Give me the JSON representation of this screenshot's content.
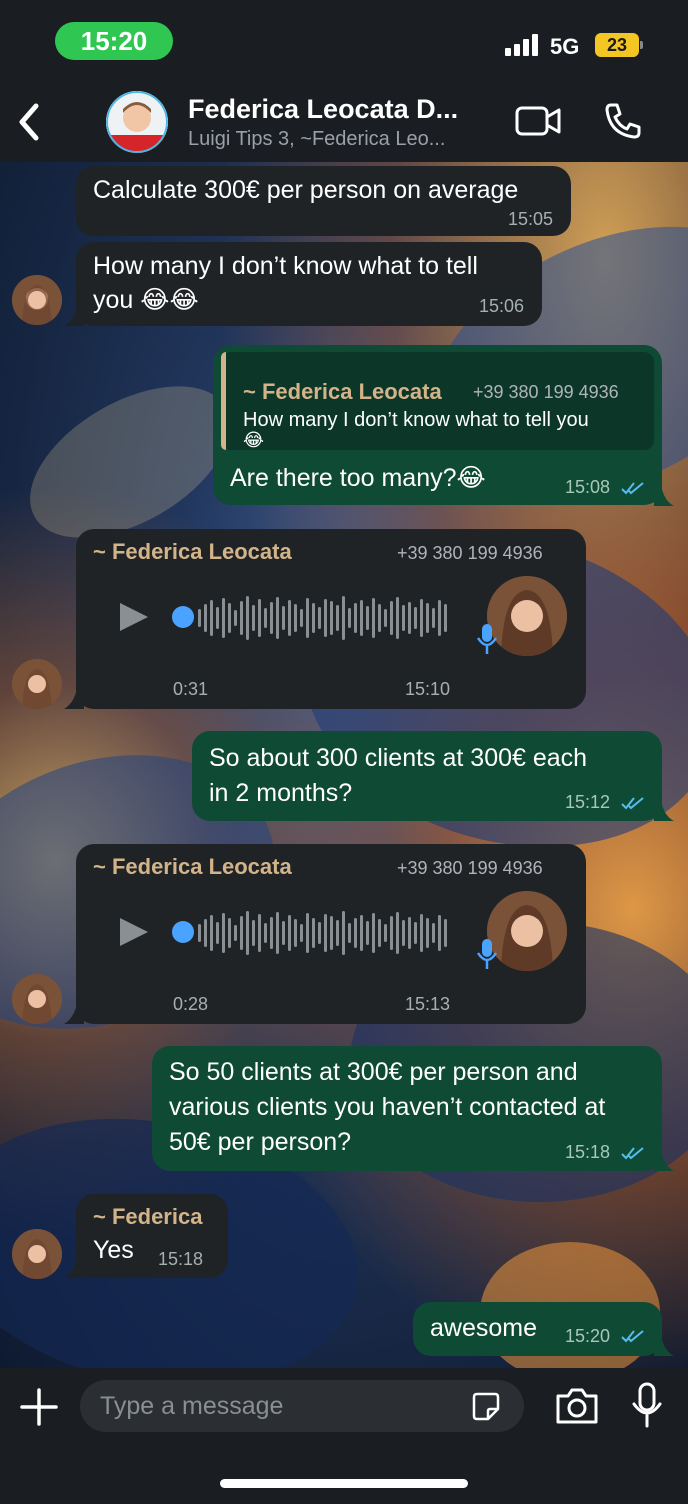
{
  "status": {
    "time": "15:20",
    "network": "5G",
    "battery": "23"
  },
  "header": {
    "title": "Federica Leocata D...",
    "subtitle": "Luigi Tips 3, ~Federica Leo..."
  },
  "messages": [
    {
      "type": "in",
      "text": "Calculate 300€ per person on average",
      "time": "15:05"
    },
    {
      "type": "in",
      "line1": "How many I don’t know what to tell",
      "line2": "you 😂😂",
      "time": "15:06"
    },
    {
      "type": "out",
      "quote_sender": "~ Federica Leocata",
      "quote_phone": "+39 380 199 4936",
      "quote_line1": "How many I don’t know what to tell you",
      "quote_line2": "😂",
      "text": "Are there too many?😂",
      "time": "15:08"
    },
    {
      "type": "voice",
      "sender": "~ Federica Leocata",
      "phone": "+39 380 199 4936",
      "duration": "0:31",
      "time": "15:10"
    },
    {
      "type": "out",
      "line1": "So about 300 clients at 300€ each",
      "line2": "in 2 months?",
      "time": "15:12"
    },
    {
      "type": "voice",
      "sender": "~ Federica Leocata",
      "phone": "+39 380 199 4936",
      "duration": "0:28",
      "time": "15:13"
    },
    {
      "type": "out",
      "line1": "So 50 clients at 300€ per person and",
      "line2": "various clients you haven’t contacted at",
      "line3": "50€ per person?",
      "time": "15:18"
    },
    {
      "type": "in",
      "sender": "~ Federica",
      "text": "Yes",
      "time": "15:18"
    },
    {
      "type": "out",
      "text": "awesome",
      "time": "15:20"
    }
  ],
  "composer": {
    "placeholder": "Type a message"
  },
  "colors": {
    "in_bubble": "#1f2326",
    "out_bubble": "#0f4a35",
    "sender": "#d3b48a",
    "read_ticks": "#53bdeb",
    "play_dot": "#4aa3ff"
  }
}
